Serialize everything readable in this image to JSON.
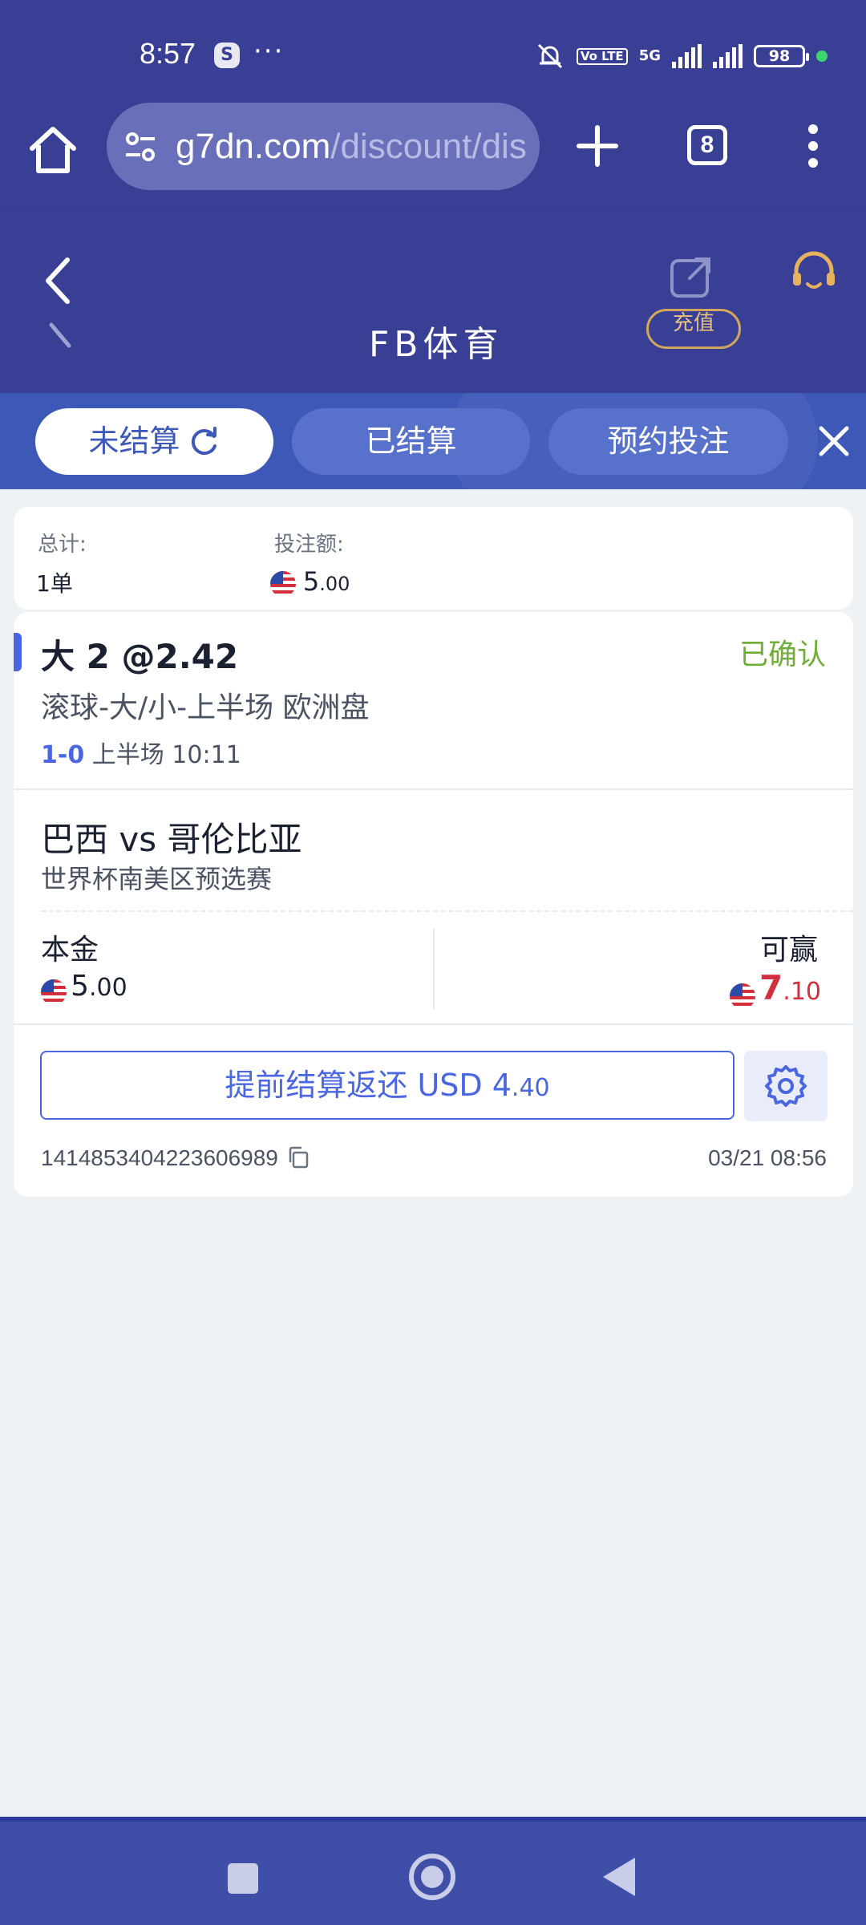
{
  "status_bar": {
    "time": "8:57",
    "s_icon": "S",
    "dots": "···",
    "volte_label": "Vo LTE",
    "network": "5G",
    "battery": "98"
  },
  "browser": {
    "url_host": "g7dn.com",
    "url_path": "/discount/dis",
    "tab_count": "8"
  },
  "app_header": {
    "partial_title": "FB体育",
    "partial_button": "充值"
  },
  "tabs": {
    "unsettled": "未结算",
    "settled": "已结算",
    "reserved": "预约投注"
  },
  "summary": {
    "total_label": "总计:",
    "total_value": "1单",
    "stake_label": "投注额:",
    "stake_big": "5",
    "stake_small": ".00"
  },
  "bet": {
    "pick": "大 2 @2.42",
    "status": "已确认",
    "market": "滚球-大/小-上半场 欧洲盘",
    "score": "1-0",
    "period": "上半场 10:11",
    "match": "巴西 vs 哥伦比亚",
    "league": "世界杯南美区预选赛",
    "stake_label": "本金",
    "stake_big": "5",
    "stake_small": ".00",
    "win_label": "可赢",
    "win_big": "7",
    "win_small": ".10",
    "cashout_main": "提前结算返还 USD 4",
    "cashout_small": ".40",
    "ticket_id": "1414853404223606989",
    "ticket_time": "03/21 08:56"
  },
  "colors": {
    "header": "#3a3f96",
    "tabstrip": "#3e58b8",
    "accent": "#4a66e0",
    "confirmed": "#6fae38",
    "win": "#d12f3f"
  }
}
